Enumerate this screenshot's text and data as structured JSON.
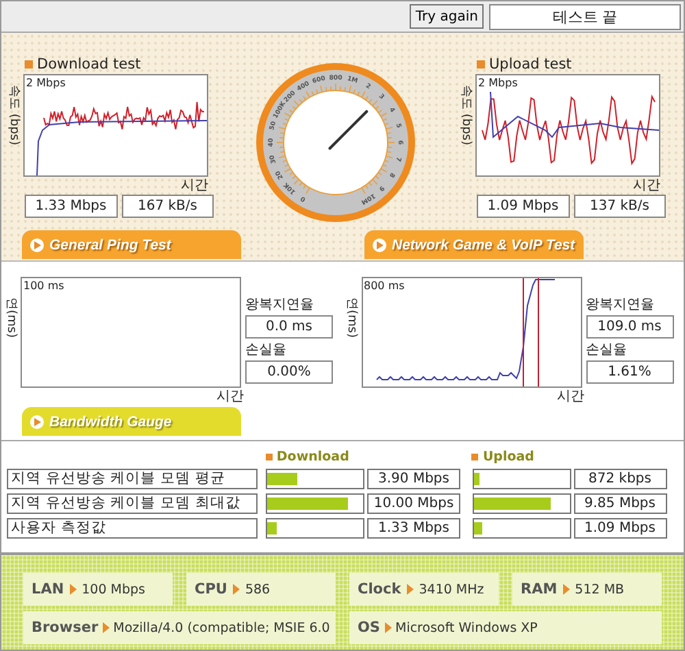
{
  "toolbar": {
    "button": "Try again",
    "status": "테스트 끝"
  },
  "download": {
    "title": "Download test",
    "axis_label": "속도 (bps)",
    "scale": "2 Mbps",
    "time_label": "시간",
    "rate": "1.33 Mbps",
    "bytes": "167 kB/s"
  },
  "gauge": {
    "level": 0.65,
    "scale_labels": [
      "0",
      "10K",
      "20",
      "30",
      "40",
      "50",
      "100K",
      "200",
      "400",
      "600",
      "800",
      "1M",
      "2",
      "3",
      "4",
      "5",
      "6",
      "7",
      "8",
      "9",
      "10M"
    ]
  },
  "upload": {
    "title": "Upload test",
    "axis_label": "속도 (bps)",
    "scale": "2 Mbps",
    "time_label": "시간",
    "rate": "1.09 Mbps",
    "bytes": "137 kB/s"
  },
  "ping_tabs": [
    {
      "label": "General Ping Test"
    },
    {
      "label": "Network Game & VoIP Test"
    }
  ],
  "ping": [
    {
      "kind": "empty",
      "axis_label": "연(ms)",
      "scale": "100 ms",
      "time_label": "시간",
      "latency_label": "왕복지연율",
      "latency": "0.0 ms",
      "loss_label": "손실율",
      "loss": "0.00%"
    },
    {
      "kind": "trace",
      "axis_label": "연(ms)",
      "scale": "800 ms",
      "time_label": "시간",
      "latency_label": "왕복지연율",
      "latency": "109.0 ms",
      "loss_label": "손실율",
      "loss": "1.61%"
    }
  ],
  "bandwidth": {
    "title": "Bandwidth Gauge",
    "download_label": "Download",
    "upload_label": "Upload",
    "rows": [
      {
        "label": "지역 유선방송 케이블 모뎀 평균",
        "download": {
          "level": 0.31,
          "value": "3.90 Mbps"
        },
        "upload": {
          "level": 0.07,
          "value": "872 kbps"
        }
      },
      {
        "label": "지역 유선방송 케이블 모뎀 최대값",
        "download": {
          "level": 0.84,
          "value": "10.00 Mbps"
        },
        "upload": {
          "level": 0.81,
          "value": "9.85 Mbps"
        }
      },
      {
        "label": "사용자 측정값",
        "download": {
          "level": 0.1,
          "value": "1.33 Mbps"
        },
        "upload": {
          "level": 0.09,
          "value": "1.09 Mbps"
        }
      }
    ]
  },
  "system_info": [
    [
      {
        "label": "LAN",
        "value": "100 Mbps"
      },
      {
        "label": "CPU",
        "value": "586"
      },
      {
        "label": "Clock",
        "value": "3410 MHz"
      },
      {
        "label": "RAM",
        "value": "512 MB"
      }
    ],
    [
      {
        "label": "Browser",
        "value": "Mozilla/4.0 (compatible; MSIE 6.0"
      },
      {
        "label": "OS",
        "value": "Microsoft Windows XP"
      }
    ]
  ]
}
